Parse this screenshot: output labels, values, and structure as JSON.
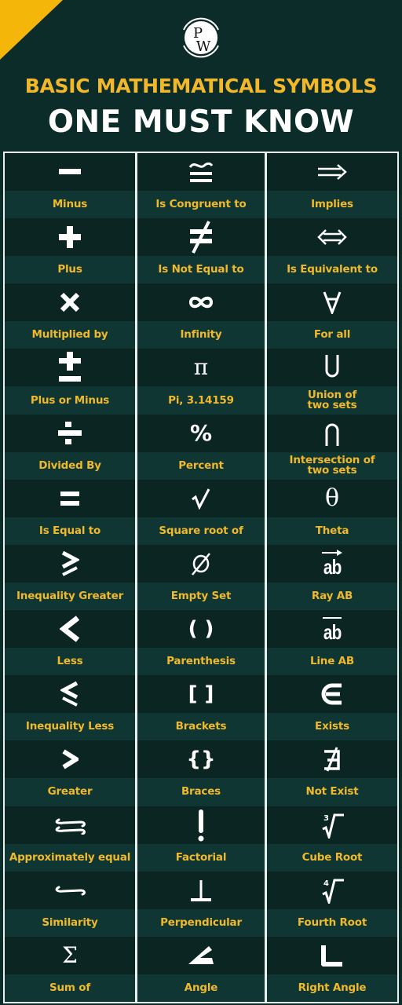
{
  "brand": {
    "logo_text_top": "P",
    "logo_text_bottom": "W",
    "accent_color": "#f5b60a",
    "background_color": "#0c2c2a"
  },
  "header": {
    "title_line1": "BASIC MATHEMATICAL SYMBOLS",
    "title_line2": "ONE MUST KNOW"
  },
  "columns": [
    {
      "items": [
        {
          "symbol": "−",
          "icon": "minus-icon",
          "label": "Minus"
        },
        {
          "symbol": "+",
          "icon": "plus-icon",
          "label": "Plus"
        },
        {
          "symbol": "×",
          "icon": "multiply-icon",
          "label": "Multiplied by"
        },
        {
          "symbol": "±",
          "icon": "plus-minus-icon",
          "label": "Plus or Minus"
        },
        {
          "symbol": "÷",
          "icon": "divide-icon",
          "label": "Divided By"
        },
        {
          "symbol": "=",
          "icon": "equals-icon",
          "label": "Is Equal to"
        },
        {
          "symbol": "⩾",
          "icon": "greater-equal-icon",
          "label": "Inequality Greater"
        },
        {
          "symbol": "<",
          "icon": "less-than-icon",
          "label": "Less"
        },
        {
          "symbol": "⩽",
          "icon": "less-equal-icon",
          "label": "Inequality Less"
        },
        {
          "symbol": ">",
          "icon": "greater-than-icon",
          "label": "Greater"
        },
        {
          "symbol": "≈",
          "icon": "approximately-equal-icon",
          "label": "Approximately equal"
        },
        {
          "symbol": "∼",
          "icon": "similarity-icon",
          "label": "Similarity"
        },
        {
          "symbol": "Σ",
          "icon": "sigma-icon",
          "label": "Sum of"
        }
      ]
    },
    {
      "items": [
        {
          "symbol": "≅",
          "icon": "congruent-icon",
          "label": "Is  Congruent  to"
        },
        {
          "symbol": "≠",
          "icon": "not-equal-icon",
          "label": "Is Not Equal to"
        },
        {
          "symbol": "∞",
          "icon": "infinity-icon",
          "label": "Infinity"
        },
        {
          "symbol": "π",
          "icon": "pi-icon",
          "label": "Pi, 3.14159"
        },
        {
          "symbol": "%",
          "icon": "percent-icon",
          "label": "Percent"
        },
        {
          "symbol": "√",
          "icon": "square-root-icon",
          "label": "Square root of"
        },
        {
          "symbol": "ø",
          "icon": "empty-set-icon",
          "label": "Empty Set"
        },
        {
          "symbol": "( )",
          "icon": "parenthesis-icon",
          "label": "Parenthesis"
        },
        {
          "symbol": "[ ]",
          "icon": "brackets-icon",
          "label": "Brackets"
        },
        {
          "symbol": "{}",
          "icon": "braces-icon",
          "label": "Braces"
        },
        {
          "symbol": "!",
          "icon": "factorial-icon",
          "label": "Factorial"
        },
        {
          "symbol": "⊥",
          "icon": "perpendicular-icon",
          "label": "Perpendicular"
        },
        {
          "symbol": "∠",
          "icon": "angle-icon",
          "label": "Angle"
        }
      ]
    },
    {
      "items": [
        {
          "symbol": "⟹",
          "icon": "implies-icon",
          "label": "Implies"
        },
        {
          "symbol": "⟺",
          "icon": "equivalent-icon",
          "label": "Is Equivalent to"
        },
        {
          "symbol": "∀",
          "icon": "for-all-icon",
          "label": "For all"
        },
        {
          "symbol": "∪",
          "icon": "union-icon",
          "label": "Union of\ntwo sets"
        },
        {
          "symbol": "∩",
          "icon": "intersection-icon",
          "label": "Intersection of\ntwo sets"
        },
        {
          "symbol": "θ",
          "icon": "theta-icon",
          "label": "Theta"
        },
        {
          "symbol": "ab",
          "icon": "ray-ab-icon",
          "label": "Ray AB"
        },
        {
          "symbol": "ab",
          "icon": "line-ab-icon",
          "label": "Line AB"
        },
        {
          "symbol": "∈",
          "icon": "element-of-icon",
          "label": "Exists"
        },
        {
          "symbol": "∄",
          "icon": "not-exists-icon",
          "label": "Not Exist"
        },
        {
          "symbol": "3",
          "icon": "cube-root-icon",
          "label": "Cube Root"
        },
        {
          "symbol": "4",
          "icon": "fourth-root-icon",
          "label": "Fourth Root"
        },
        {
          "symbol": "∟",
          "icon": "right-angle-icon",
          "label": "Right Angle"
        }
      ]
    }
  ]
}
